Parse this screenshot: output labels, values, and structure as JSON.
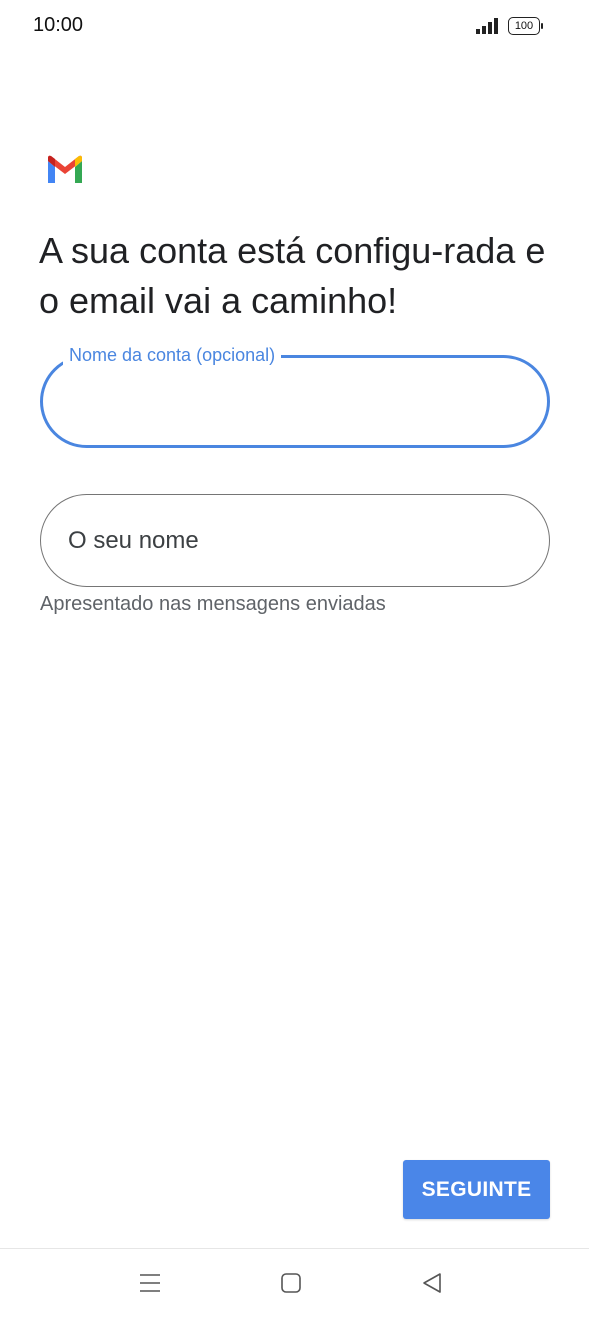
{
  "status_bar": {
    "time": "10:00",
    "battery": "100",
    "signal_icon": "signal-bars-icon"
  },
  "logo": {
    "icon": "gmail-logo-icon",
    "colors": {
      "blue": "#4285F4",
      "red": "#EA4335",
      "yellow": "#FBBC04",
      "green": "#34A853"
    }
  },
  "headline": "A sua conta está configu-rada e o email vai a caminho!",
  "account_name_field": {
    "label": "Nome da conta (opcional)",
    "value": "",
    "accent_color": "#4a86e0"
  },
  "your_name_field": {
    "placeholder": "O seu nome",
    "value": "",
    "helper": "Apresentado nas mensagens enviadas"
  },
  "next_button": {
    "label": "SEGUINTE",
    "color": "#4a86e8"
  },
  "nav_bar": {
    "menu_icon": "menu-icon",
    "home_icon": "home-square-icon",
    "back_icon": "back-triangle-icon"
  }
}
